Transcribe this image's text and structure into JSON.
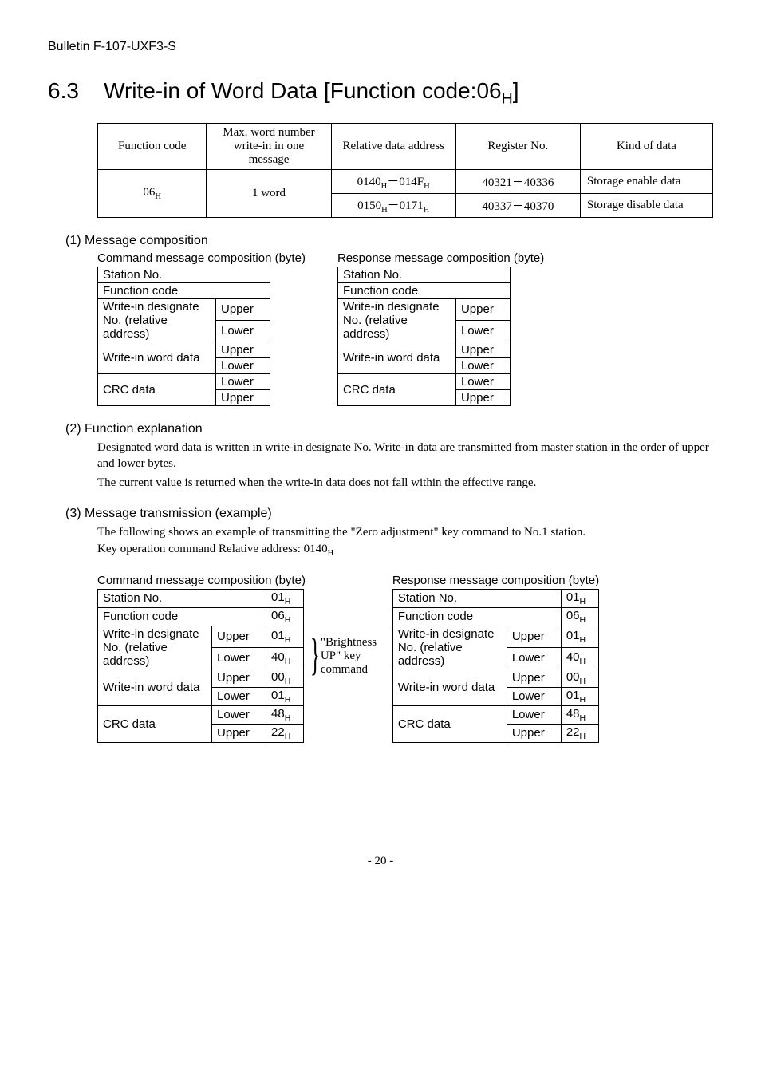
{
  "bulletin": "Bulletin F-107-UXF3-S",
  "heading": {
    "num": "6.3",
    "title_a": "Write-in of Word Data [Function code:06",
    "title_b": "]"
  },
  "main_table": {
    "h1": "Function code",
    "h2": "Max. word number write-in in one message",
    "h3": "Relative data address",
    "h4": "Register No.",
    "h5": "Kind of data",
    "r1c1": "06",
    "r1c2": "1 word",
    "r1c3a": "0140",
    "r1c3b": "014F",
    "r1c4": "40321－40336",
    "r1c5": "Storage enable data",
    "r2c3a": "0150",
    "r2c3b": "0171",
    "r2c4": "40337－40370",
    "r2c5": "Storage disable data"
  },
  "s1": {
    "hdr": "(1)  Message composition",
    "capL": "Command message composition (byte)",
    "capR": "Response message composition (byte)",
    "left": {
      "r1": "Station No.",
      "r2": "Function code",
      "r3a": "Write-in designate No. (relative address)",
      "r3b1": "Upper",
      "r3b2": "Lower",
      "r4a": "Write-in word data",
      "r4b1": "Upper",
      "r4b2": "Lower",
      "r5a": "CRC data",
      "r5b1": "Lower",
      "r5b2": "Upper"
    },
    "right": {
      "r1": "Station No.",
      "r2": "Function code",
      "r3a": "Write-in designate No. (relative address)",
      "r3b1": "Upper",
      "r3b2": "Lower",
      "r4a": "Write-in word data",
      "r4b1": "Upper",
      "r4b2": "Lower",
      "r5a": "CRC data",
      "r5b1": "Lower",
      "r5b2": "Upper"
    }
  },
  "s2": {
    "hdr": "(2)  Function explanation",
    "p1": "Designated word data is written in write-in designate No.    Write-in data are transmitted from master station in the order of upper and lower bytes.",
    "p2": "The current value is returned when the write-in data does not fall within the effective range."
  },
  "s3": {
    "hdr": "(3)  Message transmission (example)",
    "p1": "The following shows an example of transmitting the \"Zero adjustment\" key command to No.1 station.",
    "p2a": "Key operation command    Relative address: 0140",
    "capL": "Command message composition (byte)",
    "capR": "Response message composition (byte)",
    "annot": "\"Brightness UP\" key command",
    "left": {
      "r1a": "Station No.",
      "r1b": "01",
      "r2a": "Function code",
      "r2b": "06",
      "r3a": "Write-in designate No. (relative address)",
      "r3b1": "Upper",
      "r3c1": "01",
      "r3b2": "Lower",
      "r3c2": "40",
      "r4a": "Write-in word data",
      "r4b1": "Upper",
      "r4c1": "00",
      "r4b2": "Lower",
      "r4c2": "01",
      "r5a": "CRC data",
      "r5b1": "Lower",
      "r5c1": "48",
      "r5b2": "Upper",
      "r5c2": "22"
    },
    "right": {
      "r1a": "Station No.",
      "r1b": "01",
      "r2a": "Function code",
      "r2b": "06",
      "r3a": "Write-in designate No. (relative address)",
      "r3b1": "Upper",
      "r3c1": "01",
      "r3b2": "Lower",
      "r3c2": "40",
      "r4a": "Write-in word data",
      "r4b1": "Upper",
      "r4c1": "00",
      "r4b2": "Lower",
      "r4c2": "01",
      "r5a": "CRC data",
      "r5b1": "Lower",
      "r5c1": "48",
      "r5b2": "Upper",
      "r5c2": "22"
    }
  },
  "page": "- 20 -"
}
